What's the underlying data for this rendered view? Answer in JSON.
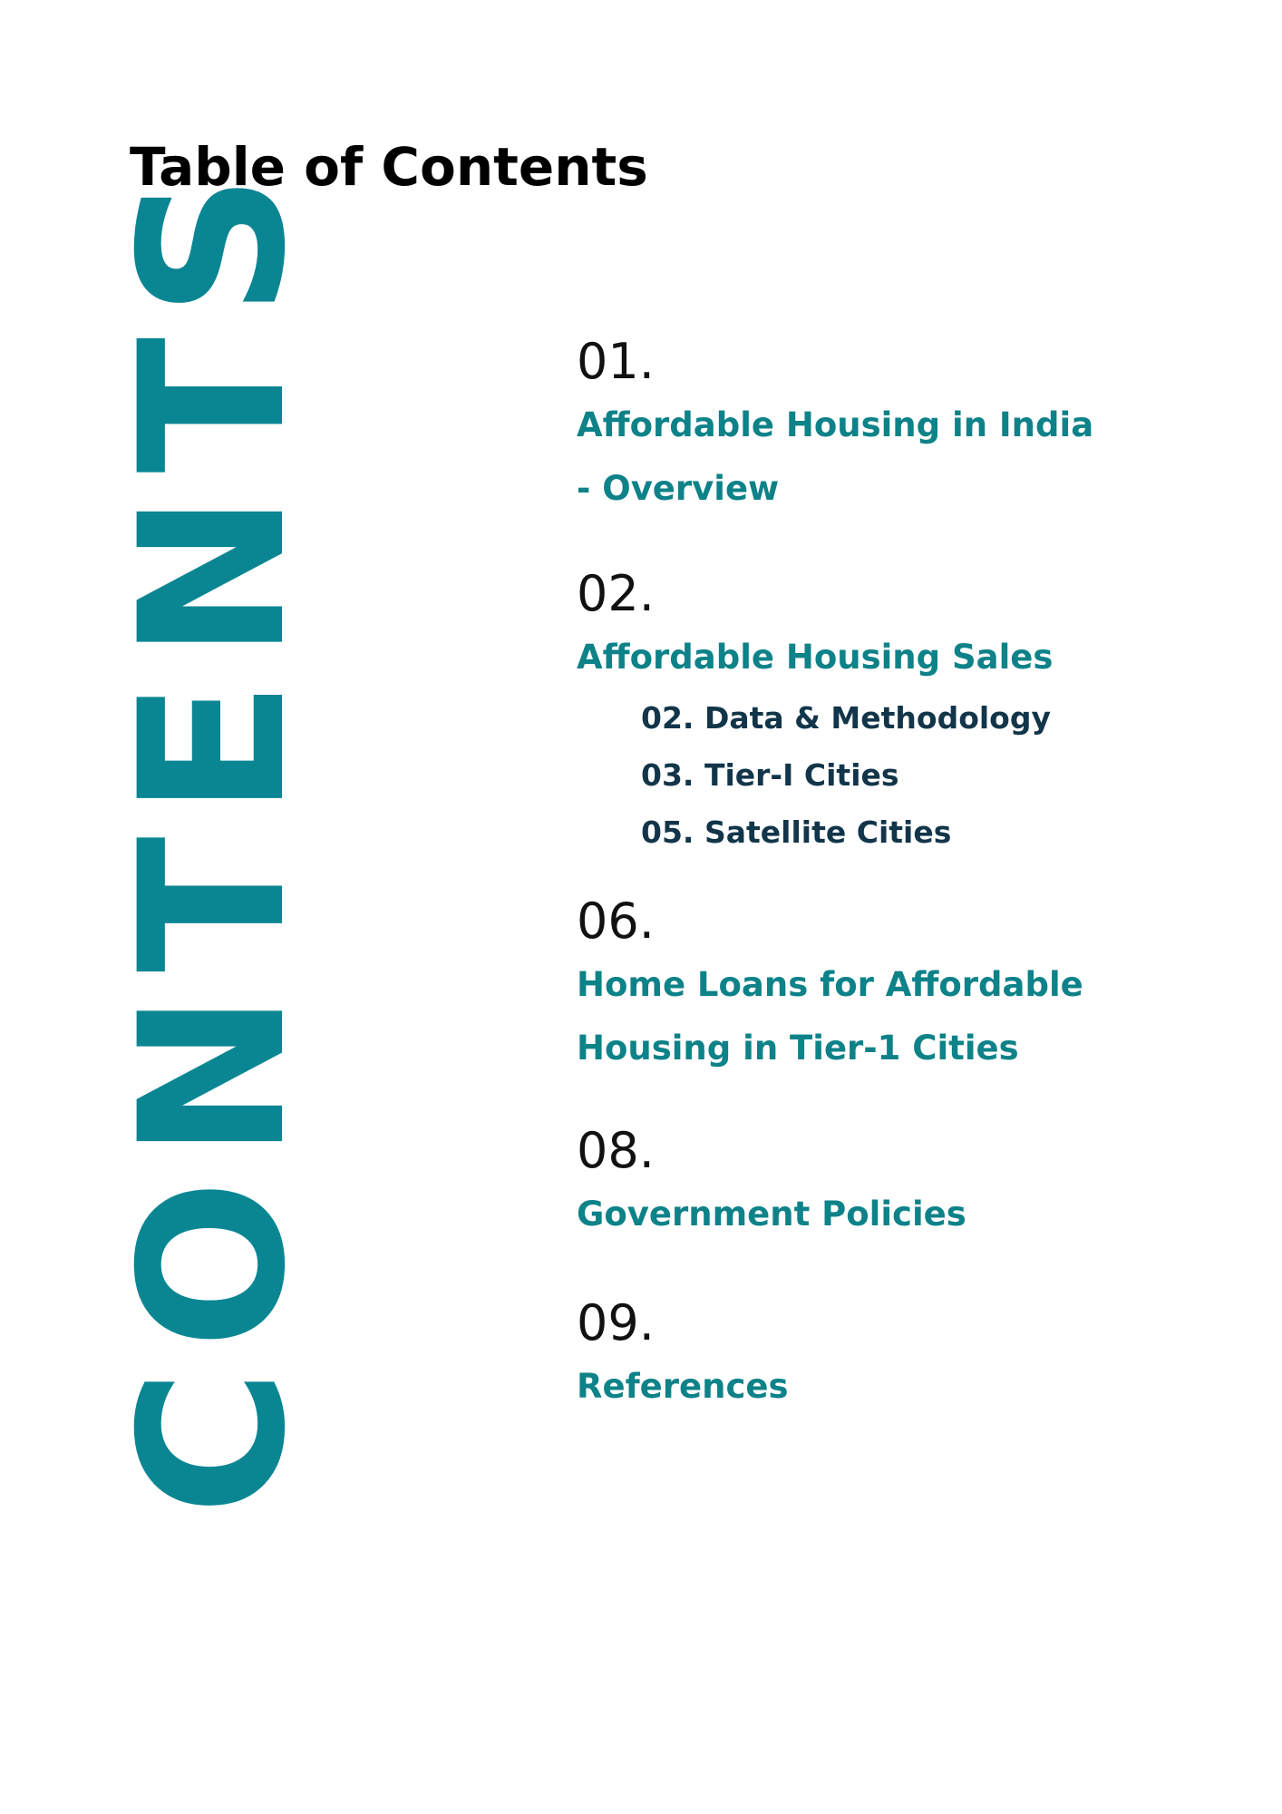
{
  "title": "Table of Contents",
  "side_word": "CONTENTS",
  "entries": [
    {
      "number": "01.",
      "heading_lines": [
        "Affordable Housing in India",
        "- Overview"
      ]
    },
    {
      "number": "02.",
      "heading_lines": [
        "Affordable Housing Sales"
      ],
      "subitems": [
        "02. Data & Methodology",
        "03. Tier-I Cities",
        "05. Satellite Cities"
      ]
    },
    {
      "number": "06.",
      "heading_lines": [
        "Home Loans for Affordable",
        "Housing in Tier-1 Cities"
      ]
    },
    {
      "number": "08.",
      "heading_lines": [
        "Government Policies"
      ]
    },
    {
      "number": "09.",
      "heading_lines": [
        "References"
      ]
    }
  ],
  "colors": {
    "accent": "#0a8693",
    "heading": "#0d8288",
    "subitem": "#12354a",
    "text": "#000000"
  }
}
